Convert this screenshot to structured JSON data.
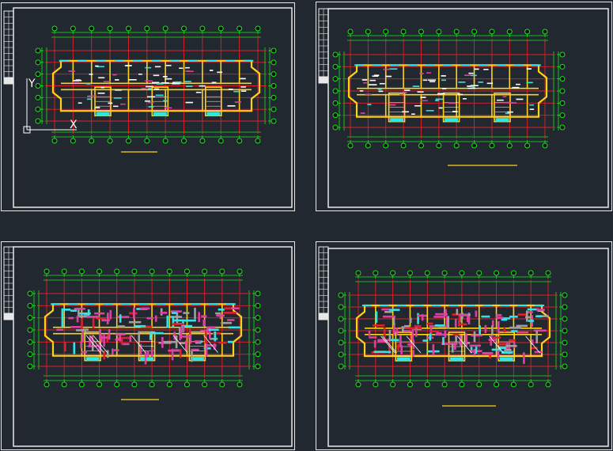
{
  "canvas": {
    "background": "#212830",
    "colors": {
      "frame": "#e8e8e8",
      "grid": "#19e619",
      "wall": "#ffd21a",
      "axis_red": "#e0202a",
      "cyan": "#2ee6ea",
      "magenta": "#e040a0",
      "gray": "#a0a0a0",
      "white": "#ffffff"
    }
  },
  "sheets": [
    {
      "id": "sheet-1",
      "variant": "plan",
      "has_ucs_icon": true
    },
    {
      "id": "sheet-2",
      "variant": "plan-alt",
      "has_ucs_icon": false
    },
    {
      "id": "sheet-3",
      "variant": "structure",
      "has_ucs_icon": false
    },
    {
      "id": "sheet-4",
      "variant": "structure-alt",
      "has_ucs_icon": false
    }
  ],
  "ucs_icon": {
    "y_label": "Y",
    "x_label": "X"
  }
}
